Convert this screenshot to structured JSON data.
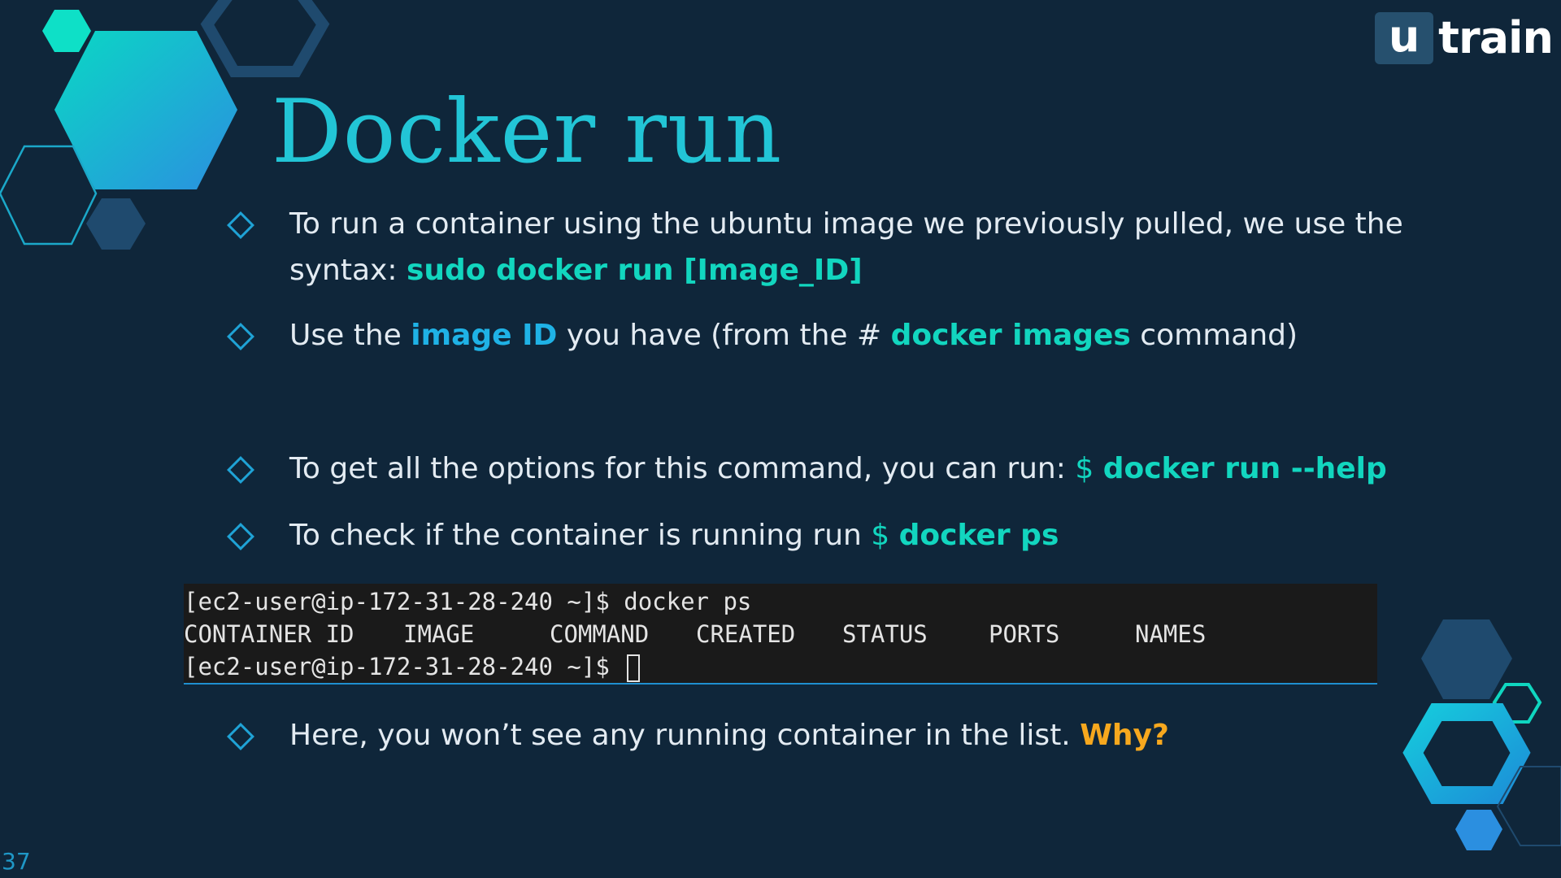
{
  "logo": {
    "u": "u",
    "text": "train"
  },
  "title": "Docker run",
  "bullets": [
    {
      "parts": [
        {
          "text": "To run a container using the ubuntu image we previously pulled, we use the syntax:  ",
          "style": "plain"
        },
        {
          "text": "sudo docker run [Image_ID]",
          "style": "teal"
        }
      ]
    },
    {
      "parts": [
        {
          "text": "Use the ",
          "style": "plain"
        },
        {
          "text": "image ID",
          "style": "blue"
        },
        {
          "text": " you have (from the # ",
          "style": "plain"
        },
        {
          "text": "docker images",
          "style": "teal"
        },
        {
          "text": " command)",
          "style": "plain"
        }
      ]
    },
    {
      "parts": [
        {
          "text": "To get all the options for this command, you can run: ",
          "style": "plain"
        },
        {
          "text": "$ ",
          "style": "dollar"
        },
        {
          "text": "docker run --help",
          "style": "teal"
        }
      ]
    },
    {
      "parts": [
        {
          "text": "To check if the container is running run ",
          "style": "plain"
        },
        {
          "text": "$ ",
          "style": "dollar"
        },
        {
          "text": "docker ps",
          "style": "teal"
        }
      ]
    },
    {
      "parts": [
        {
          "text": "Here, you won’t see any running container in the list. ",
          "style": "plain"
        },
        {
          "text": "Why?",
          "style": "orange"
        }
      ]
    }
  ],
  "terminal": {
    "line1": "[ec2-user@ip-172-31-28-240 ~]$ docker ps",
    "headers": [
      "CONTAINER ID",
      "IMAGE",
      "COMMAND",
      "CREATED",
      "STATUS",
      "PORTS",
      "NAMES"
    ],
    "line3": "[ec2-user@ip-172-31-28-240 ~]$ "
  },
  "page_number": "37",
  "colors": {
    "background": "#0f263a",
    "title": "#22c5d6",
    "highlight_teal": "#12d6bf",
    "highlight_blue": "#1fb2e6",
    "highlight_orange": "#f7a81e"
  }
}
